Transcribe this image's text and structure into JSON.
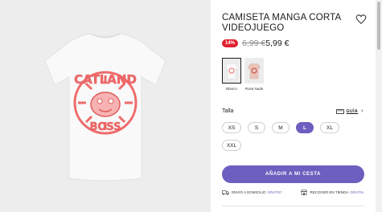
{
  "product": {
    "title": "CAMISETA MANGA CORTA VIDEOJUEGO",
    "discount_badge": "14%",
    "old_price": "6,99 €",
    "new_price": "5,99 €",
    "graphic_text_top": "CATLAND",
    "graphic_text_bottom": "BOSS"
  },
  "colors": [
    {
      "label": "Blanco",
      "selected": true
    },
    {
      "label": "Rosa Nude",
      "selected": false
    }
  ],
  "sizes": {
    "title": "Talla",
    "guide_label": "GUÍA",
    "options": [
      "XS",
      "S",
      "M",
      "L",
      "XL",
      "XXL"
    ],
    "selected": "L"
  },
  "cart": {
    "add_label": "AÑADIR A MI CESTA"
  },
  "shipping": {
    "home_label": "ENVÍO A DOMICILIO",
    "home_price": "GRATIS*",
    "store_label": "RECOGER EN TIENDA",
    "store_price": "GRATIS."
  },
  "colors_theme": {
    "accent": "#6c5fbf",
    "discount": "#e02030",
    "graphic": "#f06b6b"
  }
}
